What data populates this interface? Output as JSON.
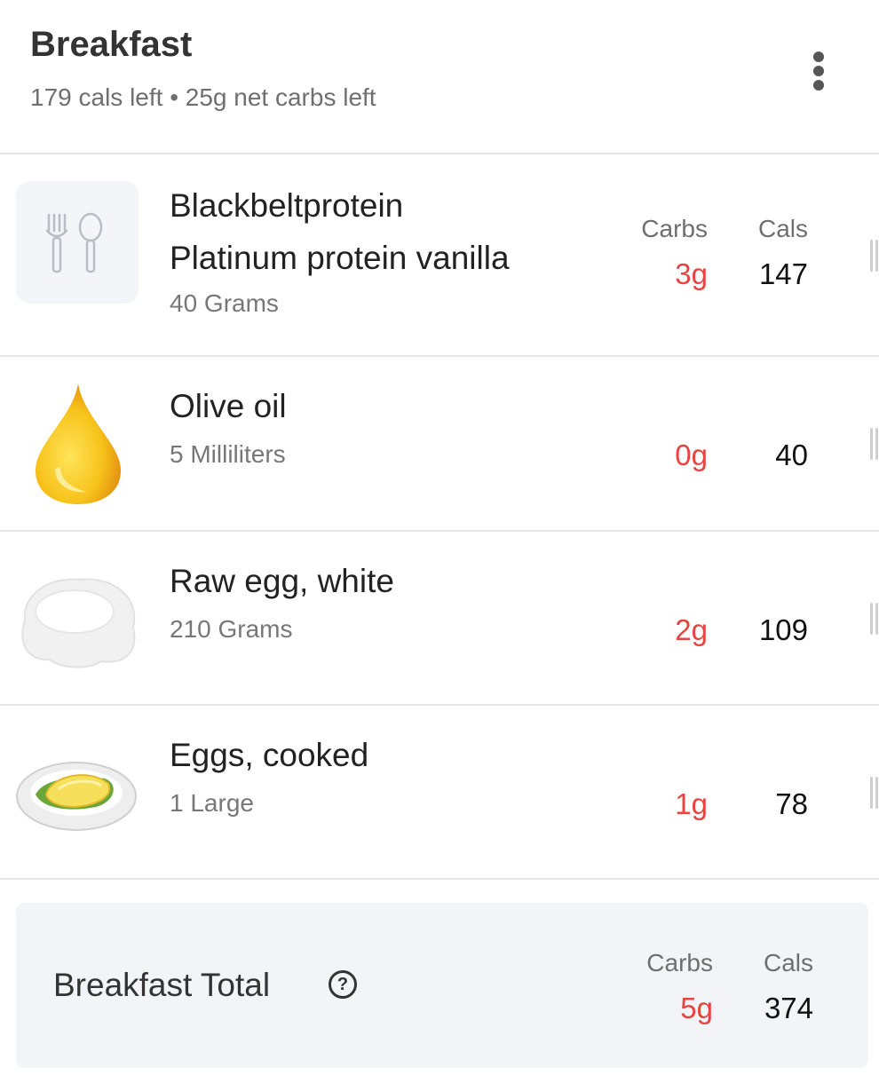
{
  "meal": {
    "title": "Breakfast",
    "summary": "179 cals left • 25g net carbs left"
  },
  "column_labels": {
    "carbs": "Carbs",
    "cals": "Cals"
  },
  "items": [
    {
      "name_line1": "Blackbeltprotein",
      "name_line2": "Platinum protein vanilla",
      "quantity": "40 Grams",
      "carbs": "3g",
      "cals": "147",
      "icon": "fork-spoon-placeholder-icon"
    },
    {
      "name_line1": "Olive oil",
      "quantity": "5 Milliliters",
      "carbs": "0g",
      "cals": "40",
      "icon": "oil-drop-icon"
    },
    {
      "name_line1": "Raw egg, white",
      "quantity": "210 Grams",
      "carbs": "2g",
      "cals": "109",
      "icon": "egg-white-icon"
    },
    {
      "name_line1": "Eggs, cooked",
      "quantity": "1 Large",
      "carbs": "1g",
      "cals": "78",
      "icon": "omelette-plate-icon"
    }
  ],
  "total": {
    "label": "Breakfast Total",
    "help_glyph": "?",
    "carbs": "5g",
    "cals": "374"
  },
  "colors": {
    "carbs_accent": "#e8433f",
    "total_card_bg": "#f2f4f8"
  }
}
